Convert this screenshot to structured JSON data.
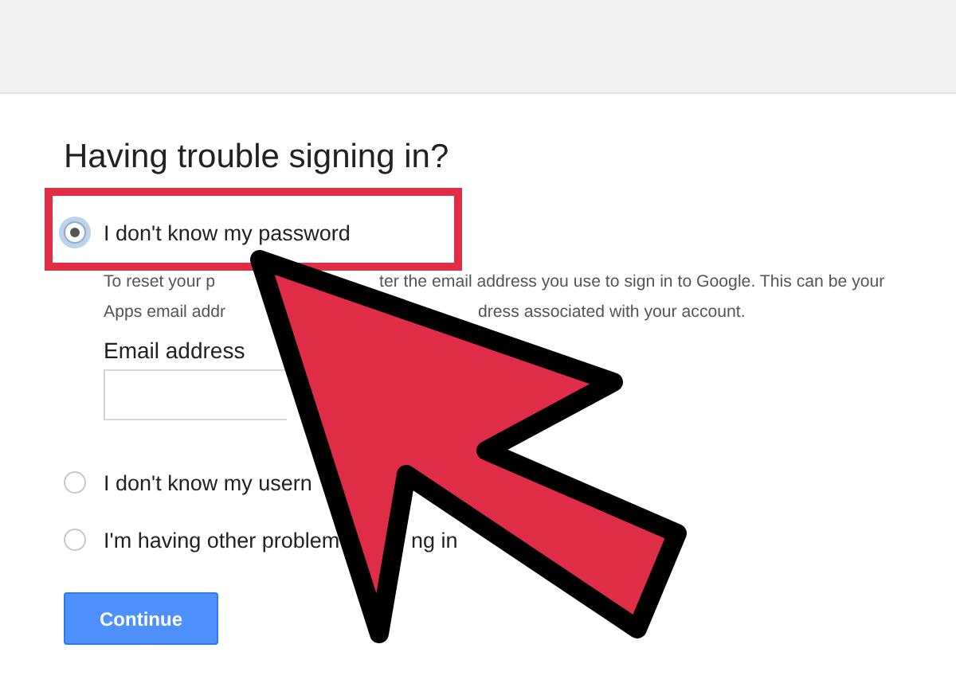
{
  "heading": "Having trouble signing in?",
  "options": [
    {
      "selected": true,
      "parts": [
        "I don't know my password"
      ]
    },
    {
      "selected": false,
      "parts": [
        "I don't know my usern"
      ]
    },
    {
      "selected": false,
      "parts": [
        "I'm having other problem",
        "ng in"
      ]
    }
  ],
  "description": [
    [
      "To reset your p",
      "ter the email address you use to sign in to Google. This can be your"
    ],
    [
      "Apps email addr",
      "dress associated with your account."
    ]
  ],
  "email": {
    "label": "Email address"
  },
  "button": "Continue"
}
